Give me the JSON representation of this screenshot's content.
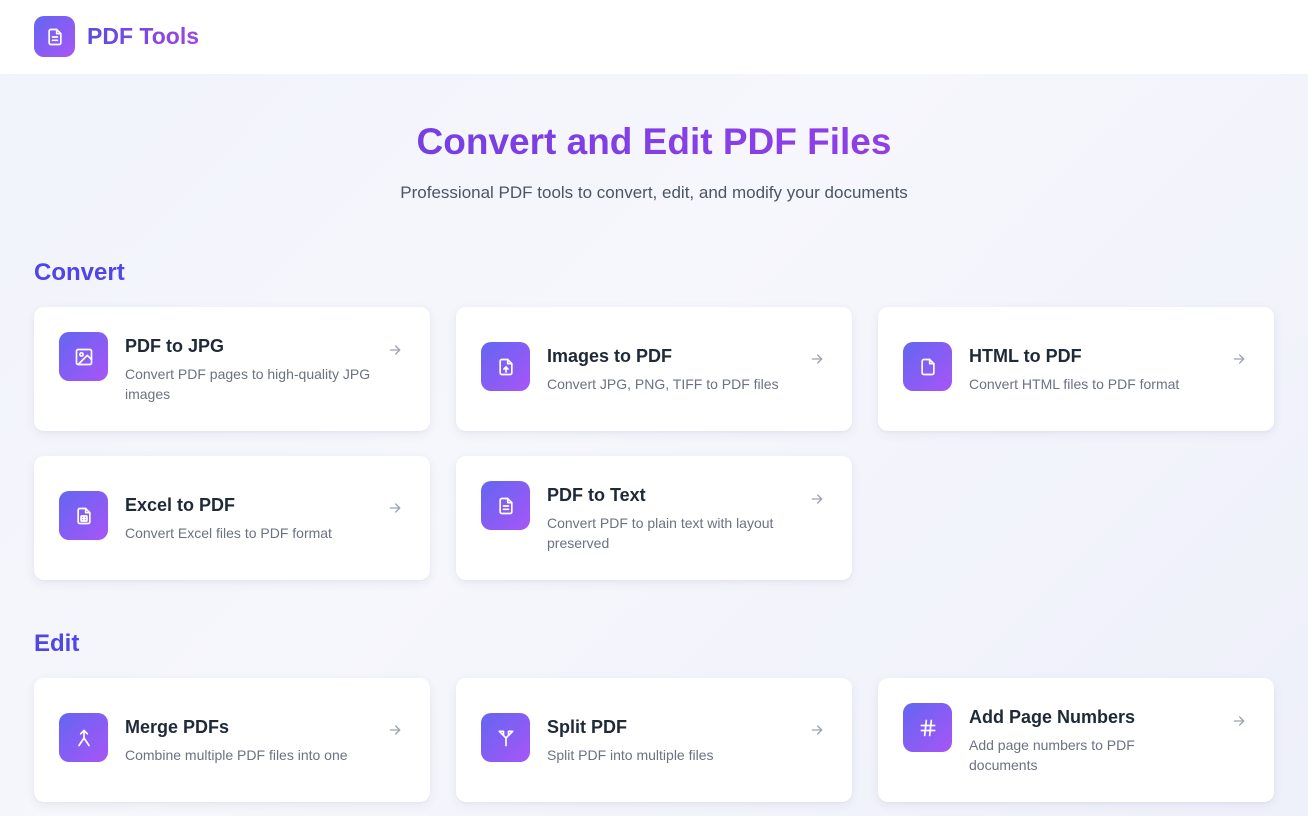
{
  "header": {
    "app_name": "PDF Tools",
    "logo_icon": "document-icon"
  },
  "hero": {
    "title": "Convert and Edit PDF Files",
    "subtitle": "Professional PDF tools to convert, edit, and modify your documents"
  },
  "sections": [
    {
      "title": "Convert",
      "tools": [
        {
          "title": "PDF to JPG",
          "description": "Convert PDF pages to high-quality JPG images",
          "icon": "image-icon"
        },
        {
          "title": "Images to PDF",
          "description": "Convert JPG, PNG, TIFF to PDF files",
          "icon": "file-upload-icon"
        },
        {
          "title": "HTML to PDF",
          "description": "Convert HTML files to PDF format",
          "icon": "file-icon"
        },
        {
          "title": "Excel to PDF",
          "description": "Convert Excel files to PDF format",
          "icon": "spreadsheet-file-icon"
        },
        {
          "title": "PDF to Text",
          "description": "Convert PDF to plain text with layout preserved",
          "icon": "text-file-icon"
        }
      ]
    },
    {
      "title": "Edit",
      "tools": [
        {
          "title": "Merge PDFs",
          "description": "Combine multiple PDF files into one",
          "icon": "merge-icon"
        },
        {
          "title": "Split PDF",
          "description": "Split PDF into multiple files",
          "icon": "split-icon"
        },
        {
          "title": "Add Page Numbers",
          "description": "Add page numbers to PDF documents",
          "icon": "hash-icon"
        }
      ]
    }
  ],
  "colors": {
    "accent_start": "#6366f1",
    "accent_end": "#a855f7",
    "section_title": "#4f46e5"
  }
}
